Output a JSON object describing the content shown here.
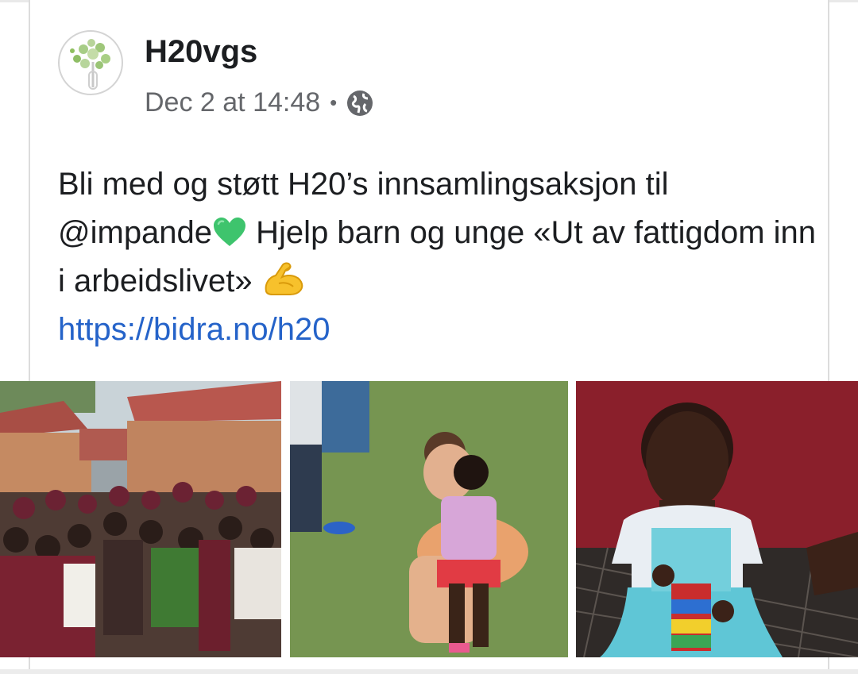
{
  "post": {
    "page_name": "H20vgs",
    "timestamp": "Dec 2 at 14:48",
    "separator": "•",
    "audience_icon": "globe-icon",
    "text_part1": "Bli med og støtt H20’s innsamlingsaksjon til @impande",
    "heart_emoji": "green-heart-icon",
    "text_part2": " Hjelp barn og unge «Ut av fattigdom inn i arbeidslivet» ",
    "muscle_emoji": "flexed-biceps-icon",
    "link": "https://bidra.no/h20"
  },
  "photos": [
    {
      "name": "photo-students-group",
      "alt": "group of students"
    },
    {
      "name": "photo-woman-child",
      "alt": "woman with child"
    },
    {
      "name": "photo-girl-blocks",
      "alt": "girl with blocks"
    }
  ],
  "colors": {
    "text": "#1c1e21",
    "meta": "#65676b",
    "link": "#2563c9",
    "heart": "#3ec46d"
  }
}
